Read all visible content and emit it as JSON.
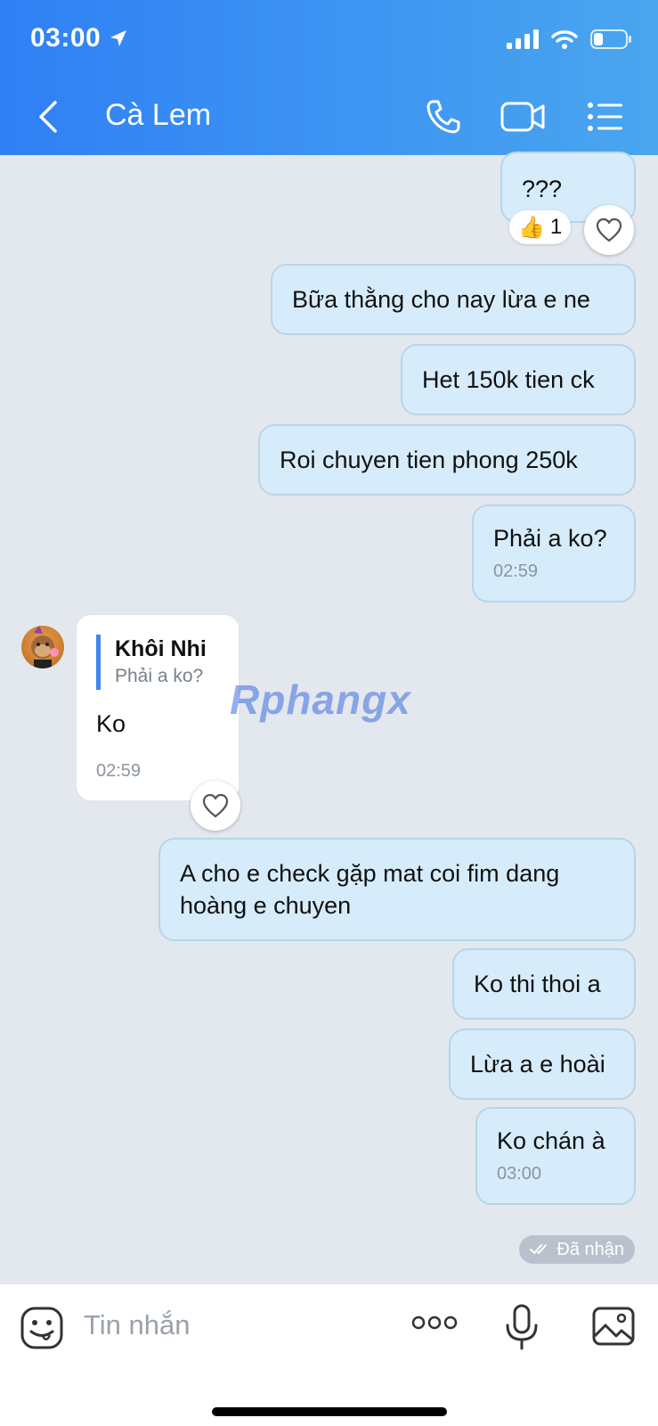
{
  "status_bar": {
    "time": "03:00"
  },
  "header": {
    "title": "Cà Lem"
  },
  "messages": [
    {
      "text": "???",
      "reaction_count": "1"
    },
    {
      "text": "Bữa thằng cho nay lừa e ne"
    },
    {
      "text": "Het 150k tien ck"
    },
    {
      "text": "Roi chuyen tien phong 250k"
    },
    {
      "text": "Phải a ko?",
      "time": "02:59"
    },
    {
      "quote_name": "Khôi Nhi",
      "quote_text": "Phải a ko?",
      "text": "Ko",
      "time": "02:59"
    },
    {
      "text": "A cho e check gặp mat coi fim dang hoàng e chuyen"
    },
    {
      "text": "Ko thi thoi a"
    },
    {
      "text": "Lừa a e hoài"
    },
    {
      "text": "Ko chán à",
      "time": "03:00"
    }
  ],
  "watermark": "Rphangx",
  "seen_status": "Đã nhận",
  "composer": {
    "placeholder": "Tin nhắn"
  },
  "colors": {
    "header_start": "#2f80f5",
    "header_end": "#4aa6ef",
    "sent_bubble": "#d6ecfa",
    "received_bubble": "#ffffff",
    "accent": "#3f86f0"
  }
}
